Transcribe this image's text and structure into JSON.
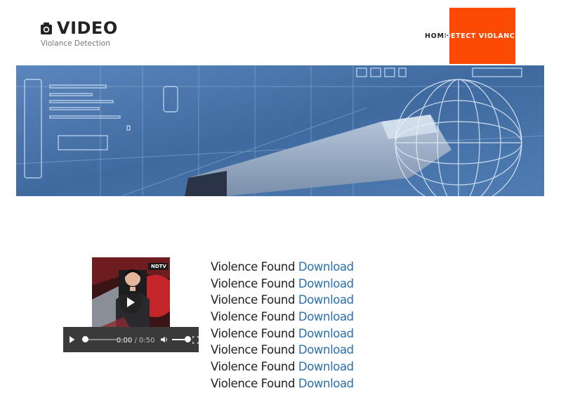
{
  "brand": {
    "name": "VIDEO",
    "tagline": "Violance Detection"
  },
  "nav": {
    "home": "HOME",
    "detect": "DETECT VIOLANCE",
    "accent": "#fb4a04"
  },
  "banner": {
    "tone": "#4a74a8"
  },
  "video": {
    "current_time": "0:00",
    "duration": "0:50",
    "thumbnail_caption": "NDTV"
  },
  "results": [
    {
      "status": "Violence Found",
      "link": "Download"
    },
    {
      "status": "Violence Found",
      "link": "Download"
    },
    {
      "status": "Violence Found",
      "link": "Download"
    },
    {
      "status": "Violence Found",
      "link": "Download"
    },
    {
      "status": "Violence Found",
      "link": "Download"
    },
    {
      "status": "Violence Found",
      "link": "Download"
    },
    {
      "status": "Violence Found",
      "link": "Download"
    },
    {
      "status": "Violence Found",
      "link": "Download"
    }
  ]
}
